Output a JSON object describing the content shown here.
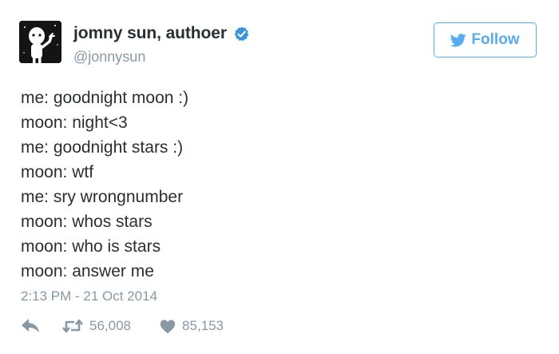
{
  "author": {
    "display_name": "jomny sun, authoer",
    "handle": "@jonnysun",
    "verified": true
  },
  "follow_button": {
    "label": "Follow",
    "icon": "twitter-bird-icon"
  },
  "tweet": {
    "lines": [
      "me: goodnight moon :)",
      "moon: night<3",
      "me: goodnight stars :)",
      "moon: wtf",
      "me: sry wrongnumber",
      "moon: whos stars",
      "moon: who is stars",
      "moon: answer me"
    ],
    "timestamp": "2:13 PM - 21 Oct 2014"
  },
  "actions": {
    "reply": {
      "icon": "reply-icon"
    },
    "retweet": {
      "icon": "retweet-icon",
      "count": "56,008"
    },
    "like": {
      "icon": "heart-icon",
      "count": "85,153"
    }
  },
  "colors": {
    "accent": "#55acee",
    "text": "#292f33",
    "muted": "#8899a6",
    "verified_badge": "#3b94d9"
  }
}
